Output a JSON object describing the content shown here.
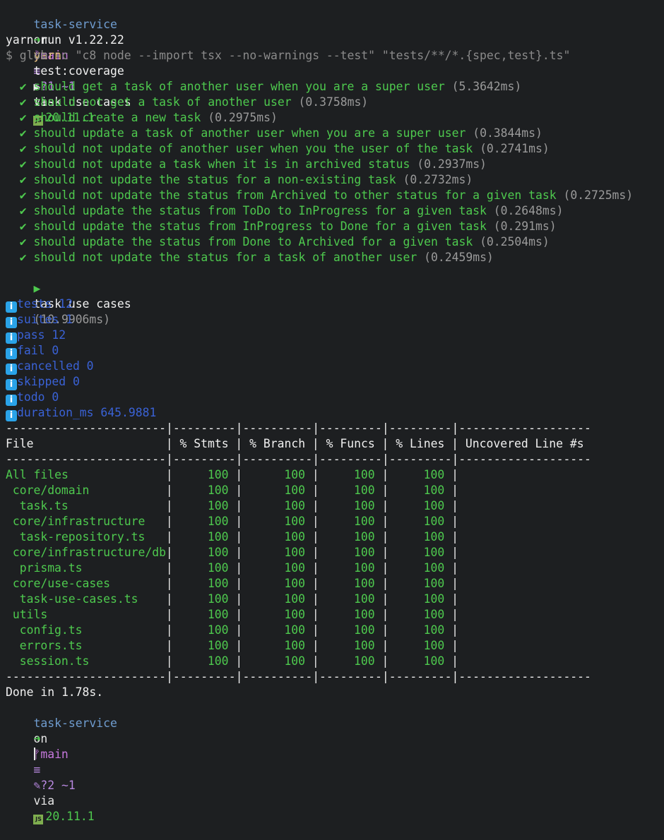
{
  "prompt1": {
    "dir": "task-service",
    "on": "on",
    "branch_icon": "git-branch-icon",
    "branch": "main",
    "stash": "≡",
    "status": "?1 ~1",
    "via": "via",
    "node": "20.11.1"
  },
  "command1": {
    "arrow": "➜",
    "cmd": "yarn",
    "args": "test:coverage"
  },
  "yarn_version": "yarn run v1.22.22",
  "glob_cmd": "$ glob -c \"c8 node --import tsx --no-warnings --test\" \"tests/**/*.{spec,test}.ts\"",
  "suite": {
    "open_marker": "▶",
    "name": "task use cases",
    "tests": [
      {
        "label": "should get a task of another user when you are a super user",
        "time": "(5.3642ms)"
      },
      {
        "label": "should not get a task of another user",
        "time": "(0.3758ms)"
      },
      {
        "label": "should create a new task",
        "time": "(0.2975ms)"
      },
      {
        "label": "should update a task of another user when you are a super user",
        "time": "(0.3844ms)"
      },
      {
        "label": "should not update of another user when you the user of the task",
        "time": "(0.2741ms)"
      },
      {
        "label": "should not update a task when it is in archived status",
        "time": "(0.2937ms)"
      },
      {
        "label": "should not update the status for a non-existing task",
        "time": "(0.2732ms)"
      },
      {
        "label": "should not update the status from Archived to other status for a given task",
        "time": "(0.2725ms)"
      },
      {
        "label": "should update the status from ToDo to InProgress for a given task",
        "time": "(0.2648ms)"
      },
      {
        "label": "should update the status from InProgress to Done for a given task",
        "time": "(0.291ms)"
      },
      {
        "label": "should update the status from Done to Archived for a given task",
        "time": "(0.2504ms)"
      },
      {
        "label": "should not update the status for a task of another user",
        "time": "(0.2459ms)"
      }
    ],
    "summary_name": "task use cases",
    "summary_time": "(10.9906ms)"
  },
  "stats": [
    "tests 12",
    "suites 1",
    "pass 12",
    "fail 0",
    "cancelled 0",
    "skipped 0",
    "todo 0",
    "duration_ms 645.9881"
  ],
  "coverage": {
    "separator": "-----------------------|---------|----------|---------|---------|-------------------",
    "headers": [
      "File",
      "% Stmts",
      "% Branch",
      "% Funcs",
      "% Lines",
      "Uncovered Line #s"
    ],
    "rows": [
      {
        "file": "All files",
        "indent": 0,
        "stmts": "100",
        "branch": "100",
        "funcs": "100",
        "lines": "100"
      },
      {
        "file": "core/domain",
        "indent": 1,
        "stmts": "100",
        "branch": "100",
        "funcs": "100",
        "lines": "100"
      },
      {
        "file": "task.ts",
        "indent": 2,
        "stmts": "100",
        "branch": "100",
        "funcs": "100",
        "lines": "100"
      },
      {
        "file": "core/infrastructure",
        "indent": 1,
        "stmts": "100",
        "branch": "100",
        "funcs": "100",
        "lines": "100"
      },
      {
        "file": "task-repository.ts",
        "indent": 2,
        "stmts": "100",
        "branch": "100",
        "funcs": "100",
        "lines": "100"
      },
      {
        "file": "core/infrastructure/db",
        "indent": 1,
        "stmts": "100",
        "branch": "100",
        "funcs": "100",
        "lines": "100"
      },
      {
        "file": "prisma.ts",
        "indent": 2,
        "stmts": "100",
        "branch": "100",
        "funcs": "100",
        "lines": "100"
      },
      {
        "file": "core/use-cases",
        "indent": 1,
        "stmts": "100",
        "branch": "100",
        "funcs": "100",
        "lines": "100"
      },
      {
        "file": "task-use-cases.ts",
        "indent": 2,
        "stmts": "100",
        "branch": "100",
        "funcs": "100",
        "lines": "100"
      },
      {
        "file": "utils",
        "indent": 1,
        "stmts": "100",
        "branch": "100",
        "funcs": "100",
        "lines": "100"
      },
      {
        "file": "config.ts",
        "indent": 2,
        "stmts": "100",
        "branch": "100",
        "funcs": "100",
        "lines": "100"
      },
      {
        "file": "errors.ts",
        "indent": 2,
        "stmts": "100",
        "branch": "100",
        "funcs": "100",
        "lines": "100"
      },
      {
        "file": "session.ts",
        "indent": 2,
        "stmts": "100",
        "branch": "100",
        "funcs": "100",
        "lines": "100"
      }
    ]
  },
  "done": "Done in 1.78s.",
  "prompt2": {
    "dir": "task-service",
    "on": "on",
    "branch": "main",
    "stash": "≡",
    "status": "?2 ~1",
    "via": "via",
    "node": "20.11.1"
  },
  "command2": {
    "arrow": "➜"
  },
  "icons": {
    "check": "✔",
    "info": "i",
    "node_badge": "JS",
    "edit": "✎"
  }
}
